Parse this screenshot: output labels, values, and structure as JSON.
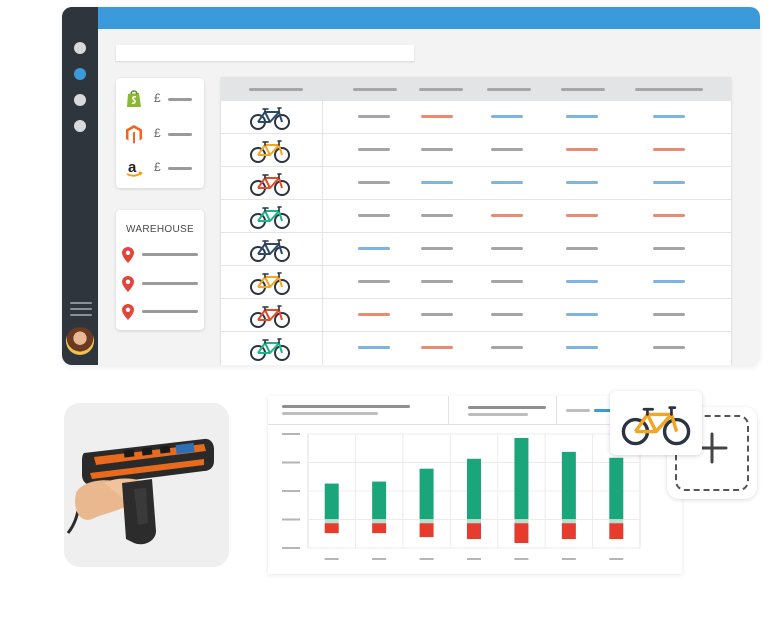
{
  "colors": {
    "accent_blue": "#3b9ad9",
    "rail_dark": "#2f353d",
    "bar_grey": "#a5a5a5",
    "bar_blue": "#7fb3e0",
    "bar_salmon": "#ec8a6f",
    "chart_green": "#1aa57a",
    "chart_red": "#e53c2d"
  },
  "channels": [
    {
      "icon": "shopify-icon",
      "currency": "£"
    },
    {
      "icon": "magento-icon",
      "currency": "£"
    },
    {
      "icon": "amazon-icon",
      "currency": "£"
    }
  ],
  "warehouse": {
    "title": "WAREHOUSE",
    "locations": [
      "pin-icon",
      "pin-icon",
      "pin-icon"
    ]
  },
  "products": [
    {
      "bike_color": "#2c4a6e",
      "cells": [
        "grey",
        "salmon",
        "blue",
        "blue",
        "blue"
      ]
    },
    {
      "bike_color": "#f2a623",
      "cells": [
        "grey",
        "grey",
        "grey",
        "salmon",
        "salmon"
      ]
    },
    {
      "bike_color": "#e34c2a",
      "cells": [
        "grey",
        "blue",
        "blue",
        "blue",
        "blue"
      ]
    },
    {
      "bike_color": "#1fb28a",
      "cells": [
        "grey",
        "grey",
        "salmon",
        "salmon",
        "salmon"
      ]
    },
    {
      "bike_color": "#2c4a6e",
      "cells": [
        "blue",
        "grey",
        "grey",
        "grey",
        "grey"
      ]
    },
    {
      "bike_color": "#f2a623",
      "cells": [
        "grey",
        "grey",
        "grey",
        "blue",
        "blue"
      ]
    },
    {
      "bike_color": "#e34c2a",
      "cells": [
        "salmon",
        "grey",
        "grey",
        "blue",
        "grey"
      ]
    },
    {
      "bike_color": "#1fb28a",
      "cells": [
        "blue",
        "salmon",
        "grey",
        "blue",
        "grey"
      ]
    }
  ],
  "chart_data": {
    "type": "bar",
    "categories": [
      "",
      "",
      "",
      "",
      "",
      "",
      ""
    ],
    "series": [
      {
        "values": [
          40,
          42,
          55,
          65,
          86,
          72,
          66
        ]
      },
      {
        "values": [
          -10,
          -10,
          -14,
          -16,
          -20,
          -16,
          -16
        ]
      }
    ],
    "ylim": [
      -25,
      90
    ],
    "grid": true
  },
  "floating_bike": {
    "bike_color": "#f2a623",
    "icon": "bicycle-icon"
  },
  "add_tile": {
    "icon": "plus-icon"
  }
}
